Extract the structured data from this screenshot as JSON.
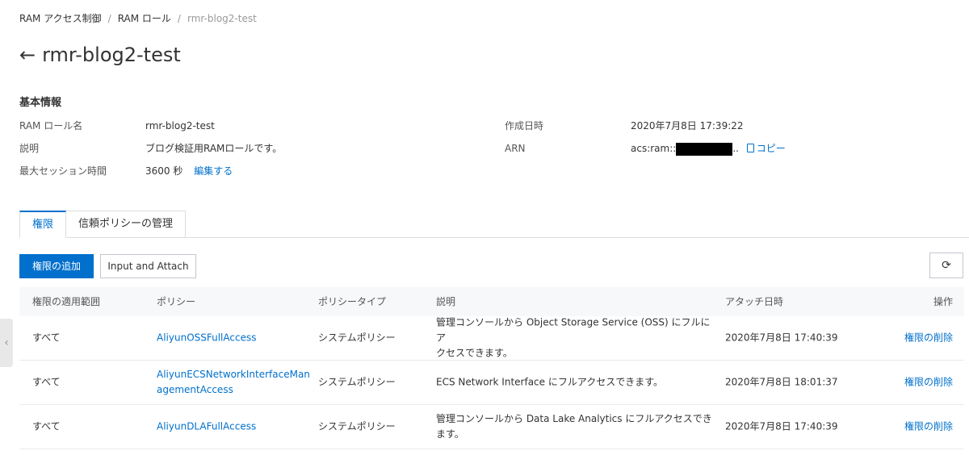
{
  "breadcrumb": {
    "items": [
      "RAM アクセス制御",
      "RAM ロール"
    ],
    "current": "rmr-blog2-test",
    "separator": "/"
  },
  "header": {
    "back_icon": "←",
    "title": "rmr-blog2-test"
  },
  "basic_info": {
    "section_title": "基本情報",
    "role_name_label": "RAM ロール名",
    "role_name_value": "rmr-blog2-test",
    "description_label": "説明",
    "description_value": "ブログ検証用RAMロールです。",
    "session_label": "最大セッション時間",
    "session_value": "3600 秒",
    "session_edit_link": "編集する",
    "created_label": "作成日時",
    "created_value": "2020年7月8日 17:39:22",
    "arn_label": "ARN",
    "arn_prefix": "acs:ram::",
    "arn_suffix": "..",
    "copy_label": "コピー"
  },
  "tabs": {
    "permissions": "権限",
    "trust_policy": "信頼ポリシーの管理"
  },
  "toolbar": {
    "add_permission_label": "権限の追加",
    "input_attach_label": "Input and Attach",
    "refresh_icon": "⟳"
  },
  "table": {
    "columns": {
      "scope": "権限の適用範囲",
      "policy": "ポリシー",
      "policy_type": "ポリシータイプ",
      "description": "説明",
      "attached_at": "アタッチ日時",
      "actions": "操作"
    },
    "rows": [
      {
        "scope": "すべて",
        "policy_line1": "AliyunOSSFullAccess",
        "policy_line2": "",
        "policy_type": "システムポリシー",
        "description_line1": "管理コンソールから Object Storage Service (OSS) にフルにア",
        "description_line2": "クセスできます。",
        "attached_at": "2020年7月8日 17:40:39",
        "action": "権限の削除"
      },
      {
        "scope": "すべて",
        "policy_line1": "AliyunECSNetworkInterfaceMan",
        "policy_line2": "agementAccess",
        "policy_type": "システムポリシー",
        "description_line1": "ECS Network Interface にフルアクセスできます。",
        "description_line2": "",
        "attached_at": "2020年7月8日 18:01:37",
        "action": "権限の削除"
      },
      {
        "scope": "すべて",
        "policy_line1": "AliyunDLAFullAccess",
        "policy_line2": "",
        "policy_type": "システムポリシー",
        "description_line1": "管理コンソールから Data Lake Analytics にフルアクセスでき",
        "description_line2": "ます。",
        "attached_at": "2020年7月8日 17:40:39",
        "action": "権限の削除"
      }
    ]
  },
  "side_tab": {
    "chevron": "‹"
  },
  "colors": {
    "primary": "#0070cc",
    "text": "#333333",
    "muted": "#999999",
    "border": "#dcdcdc",
    "table_header_bg": "#f7f8fa"
  }
}
